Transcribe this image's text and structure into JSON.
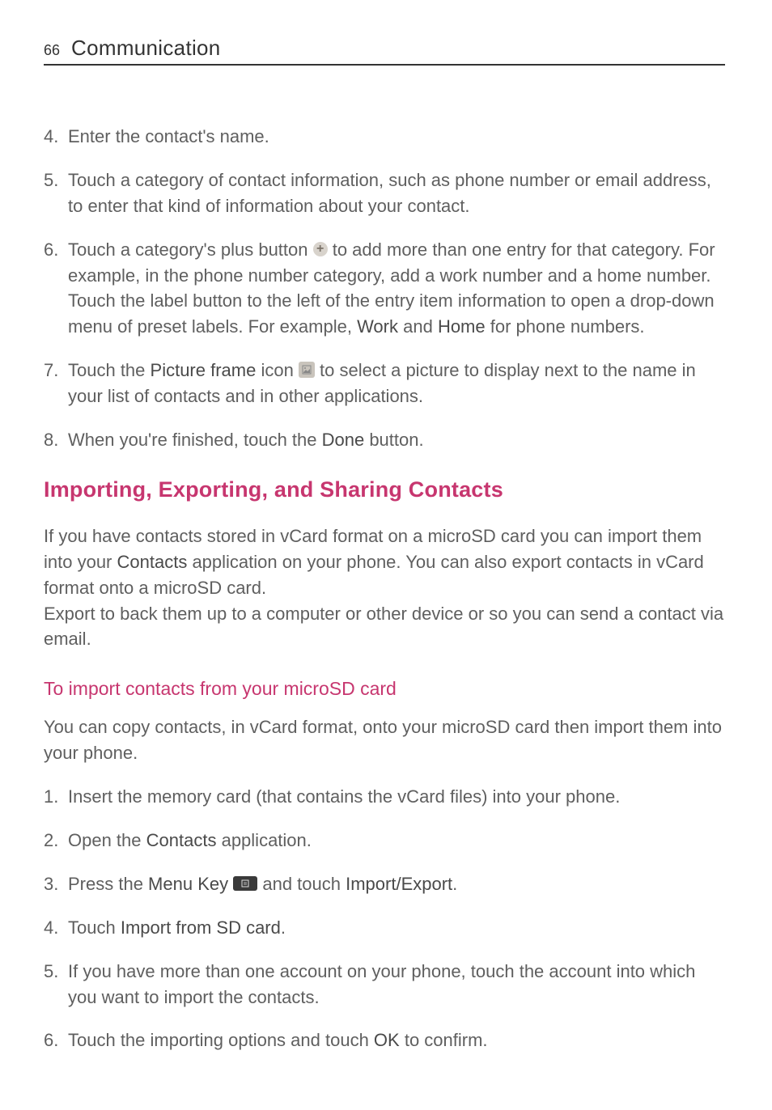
{
  "header": {
    "page_number": "66",
    "section": "Communication"
  },
  "steps_a": [
    {
      "num": "4.",
      "text": "Enter the contact's name."
    },
    {
      "num": "5.",
      "text": "Touch a category of contact information, such as phone number or email address, to enter that kind of information about your contact."
    },
    {
      "num": "6.",
      "pre": "Touch a category's plus button ",
      "post": " to add more than one entry for that category. For example, in the phone number category, add a work number and a home number. Touch the label button to the left of the entry item information to open a drop-down menu of preset labels. For example, ",
      "bold1": "Work",
      "mid": " and ",
      "bold2": "Home",
      "tail": " for phone numbers."
    },
    {
      "num": "7.",
      "pre": "Touch the ",
      "bold1": "Picture frame",
      "mid": " icon ",
      "post": " to select a picture to display next to the name in your list of contacts and in other applications."
    },
    {
      "num": "8.",
      "pre": "When you're finished, touch the ",
      "bold1": "Done",
      "post": " button."
    }
  ],
  "heading1": "Importing, Exporting, and Sharing Contacts",
  "para1_pre": "If you have contacts stored in vCard format on a microSD card you can import them into your ",
  "para1_bold": "Contacts",
  "para1_post": " application on your phone. You can also export contacts in vCard format onto a microSD card.",
  "para2": "Export to back them up to a computer or other device or so you can send a contact via email.",
  "heading2": "To import contacts from your microSD card",
  "para3": "You can copy contacts, in vCard format, onto your microSD card then import them into your phone.",
  "steps_b": [
    {
      "num": "1.",
      "text": "Insert the memory card (that contains the vCard files) into your phone."
    },
    {
      "num": "2.",
      "pre": "Open the ",
      "bold1": "Contacts",
      "post": " application."
    },
    {
      "num": "3.",
      "pre": "Press the ",
      "bold1": "Menu Key",
      "mid": " ",
      "mid2": " and touch ",
      "bold2": "Import/Export",
      "post": "."
    },
    {
      "num": "4.",
      "pre": "Touch ",
      "bold1": "Import from SD card",
      "post": "."
    },
    {
      "num": "5.",
      "text": "If you have more than one account on your phone, touch the account into which you want to import the contacts."
    },
    {
      "num": "6.",
      "pre": "Touch the importing options and touch ",
      "bold1": "OK",
      "post": " to confirm."
    }
  ]
}
